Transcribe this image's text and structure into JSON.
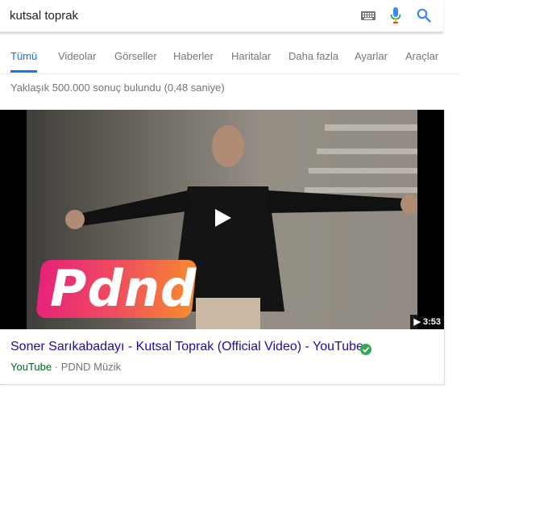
{
  "search": {
    "query": "kutsal toprak"
  },
  "tabs": [
    {
      "label": "Tümü",
      "active": true
    },
    {
      "label": "Videolar"
    },
    {
      "label": "Görseller"
    },
    {
      "label": "Haberler"
    },
    {
      "label": "Haritalar"
    },
    {
      "label": "Daha fazla"
    },
    {
      "label": "Ayarlar"
    },
    {
      "label": "Araçlar"
    }
  ],
  "stats": "Yaklaşık 500.000 sonuç bulundu (0,48 saniye)",
  "video": {
    "logo_text": "Pdnd",
    "duration": "▶ 3:53",
    "title": "Soner Sarıkabadayı - Kutsal Toprak (Official Video) - YouTube",
    "site": "YouTube",
    "separator": "·",
    "channel": "PDND Müzik"
  },
  "colors": {
    "accent": "#1a73e8",
    "link": "#1a0dab",
    "site_green": "#006621",
    "verified": "#34a853"
  },
  "icons": [
    "keyboard-icon",
    "microphone-icon",
    "search-icon",
    "play-icon",
    "verified-check-icon"
  ]
}
